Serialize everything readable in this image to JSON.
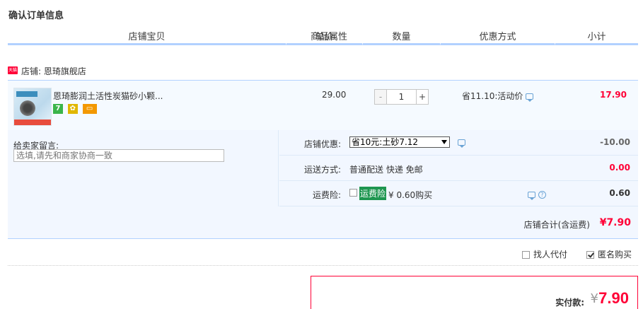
{
  "page_title": "确认订单信息",
  "columns": [
    "店铺宝贝",
    "商品属性",
    "单价",
    "数量",
    "优惠方式",
    "小计"
  ],
  "shop": {
    "badge": "天猫",
    "label": "店铺: 恩琦旗舰店"
  },
  "item": {
    "name": "恩琦膨润土活性炭猫砂小颗...",
    "service_icons": [
      "7",
      "✿",
      "▭"
    ],
    "unit_price": "29.00",
    "quantity": "1",
    "minus": "-",
    "plus": "+",
    "promo": "省11.10:活动价",
    "subtotal": "17.90"
  },
  "message": {
    "label": "给卖家留言:",
    "placeholder": "选填,请先和商家协商一致"
  },
  "shop_discount": {
    "label": "店铺优惠:",
    "selected": "省10元:土砂7.12",
    "amount": "-10.00"
  },
  "shipping": {
    "label": "运送方式:",
    "value": "普通配送 快递 免邮",
    "amount": "0.00"
  },
  "insurance": {
    "label": "运费险:",
    "highlight": "运费险",
    "price": "¥ 0.60购买",
    "help": "?",
    "amount": "0.60"
  },
  "shop_total": {
    "label": "店铺合计(含运费)",
    "value": "¥7.90"
  },
  "options": {
    "proxy_pay": "找人代付",
    "anonymous": "匿名购买",
    "anonymous_checked": true
  },
  "payment": {
    "label": "实付款:",
    "currency": "¥",
    "amount": "7.90"
  },
  "colors": {
    "accent_red": "#ff0036",
    "header_rule": "#b2d1ff",
    "panel_bg": "#f2f7ff",
    "insurance_highlight": "#1e9650"
  }
}
